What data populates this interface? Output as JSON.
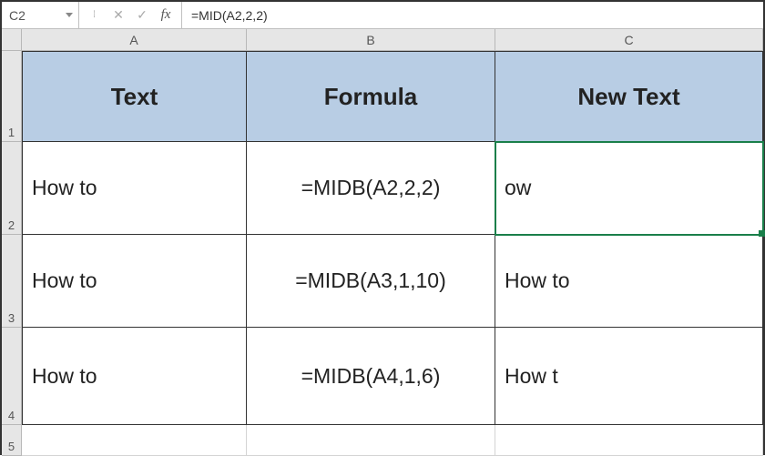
{
  "nameBox": {
    "cellRef": "C2"
  },
  "formulaBar": {
    "fxLabel": "fx",
    "formula": "=MID(A2,2,2)"
  },
  "columns": [
    "A",
    "B",
    "C"
  ],
  "rows": [
    "1",
    "2",
    "3",
    "4",
    "5"
  ],
  "headers": {
    "A1": "Text",
    "B1": "Formula",
    "C1": "New Text"
  },
  "data": {
    "A2": "How to",
    "B2": "=MIDB(A2,2,2)",
    "C2": "ow",
    "A3": "How to",
    "B3": "=MIDB(A3,1,10)",
    "C3": "How to",
    "A4": "How to",
    "B4": "=MIDB(A4,1,6)",
    "C4": "How t"
  },
  "selectedCell": "C2"
}
